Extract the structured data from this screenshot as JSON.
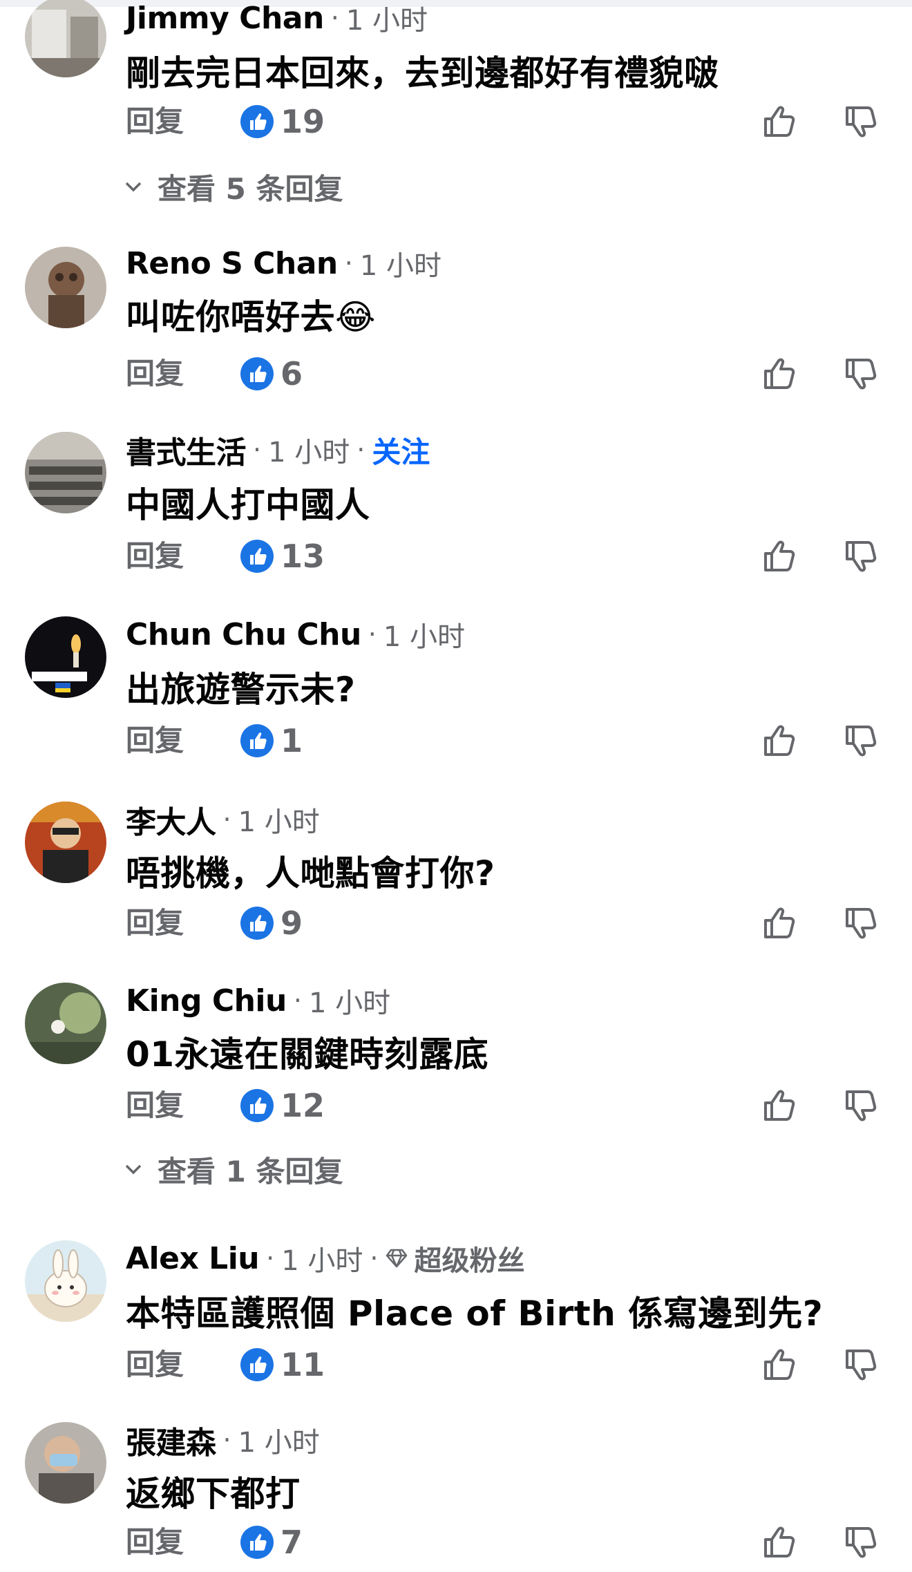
{
  "common": {
    "reply_label": "回复"
  },
  "comments": [
    {
      "name": "Jimmy Chan",
      "time": "1 小时",
      "text": "剛去完日本回來，去到邊都好有禮貌啵",
      "likes": "19",
      "view_replies": "查看 5 条回复"
    },
    {
      "name": "Reno S Chan",
      "time": "1 小时",
      "text": "叫咗你唔好去",
      "emoji": "😂",
      "likes": "6"
    },
    {
      "name": "書式生活",
      "time": "1 小时",
      "follow": "关注",
      "text": "中國人打中國人",
      "likes": "13"
    },
    {
      "name": "Chun Chu Chu",
      "time": "1 小时",
      "text": "出旅遊警示未?",
      "likes": "1"
    },
    {
      "name": "李大人",
      "time": "1 小时",
      "text": "唔挑機，人哋點會打你?",
      "likes": "9"
    },
    {
      "name": "King Chiu",
      "time": "1 小时",
      "text": "01永遠在關鍵時刻露底",
      "likes": "12",
      "view_replies": "查看 1 条回复"
    },
    {
      "name": "Alex Liu",
      "time": "1 小时",
      "badge": "超级粉丝",
      "text": "本特區護照個 Place of Birth 係寫邊到先?",
      "likes": "11"
    },
    {
      "name": "張建森",
      "time": "1 小时",
      "text": "返鄉下都打",
      "likes": "7"
    }
  ]
}
